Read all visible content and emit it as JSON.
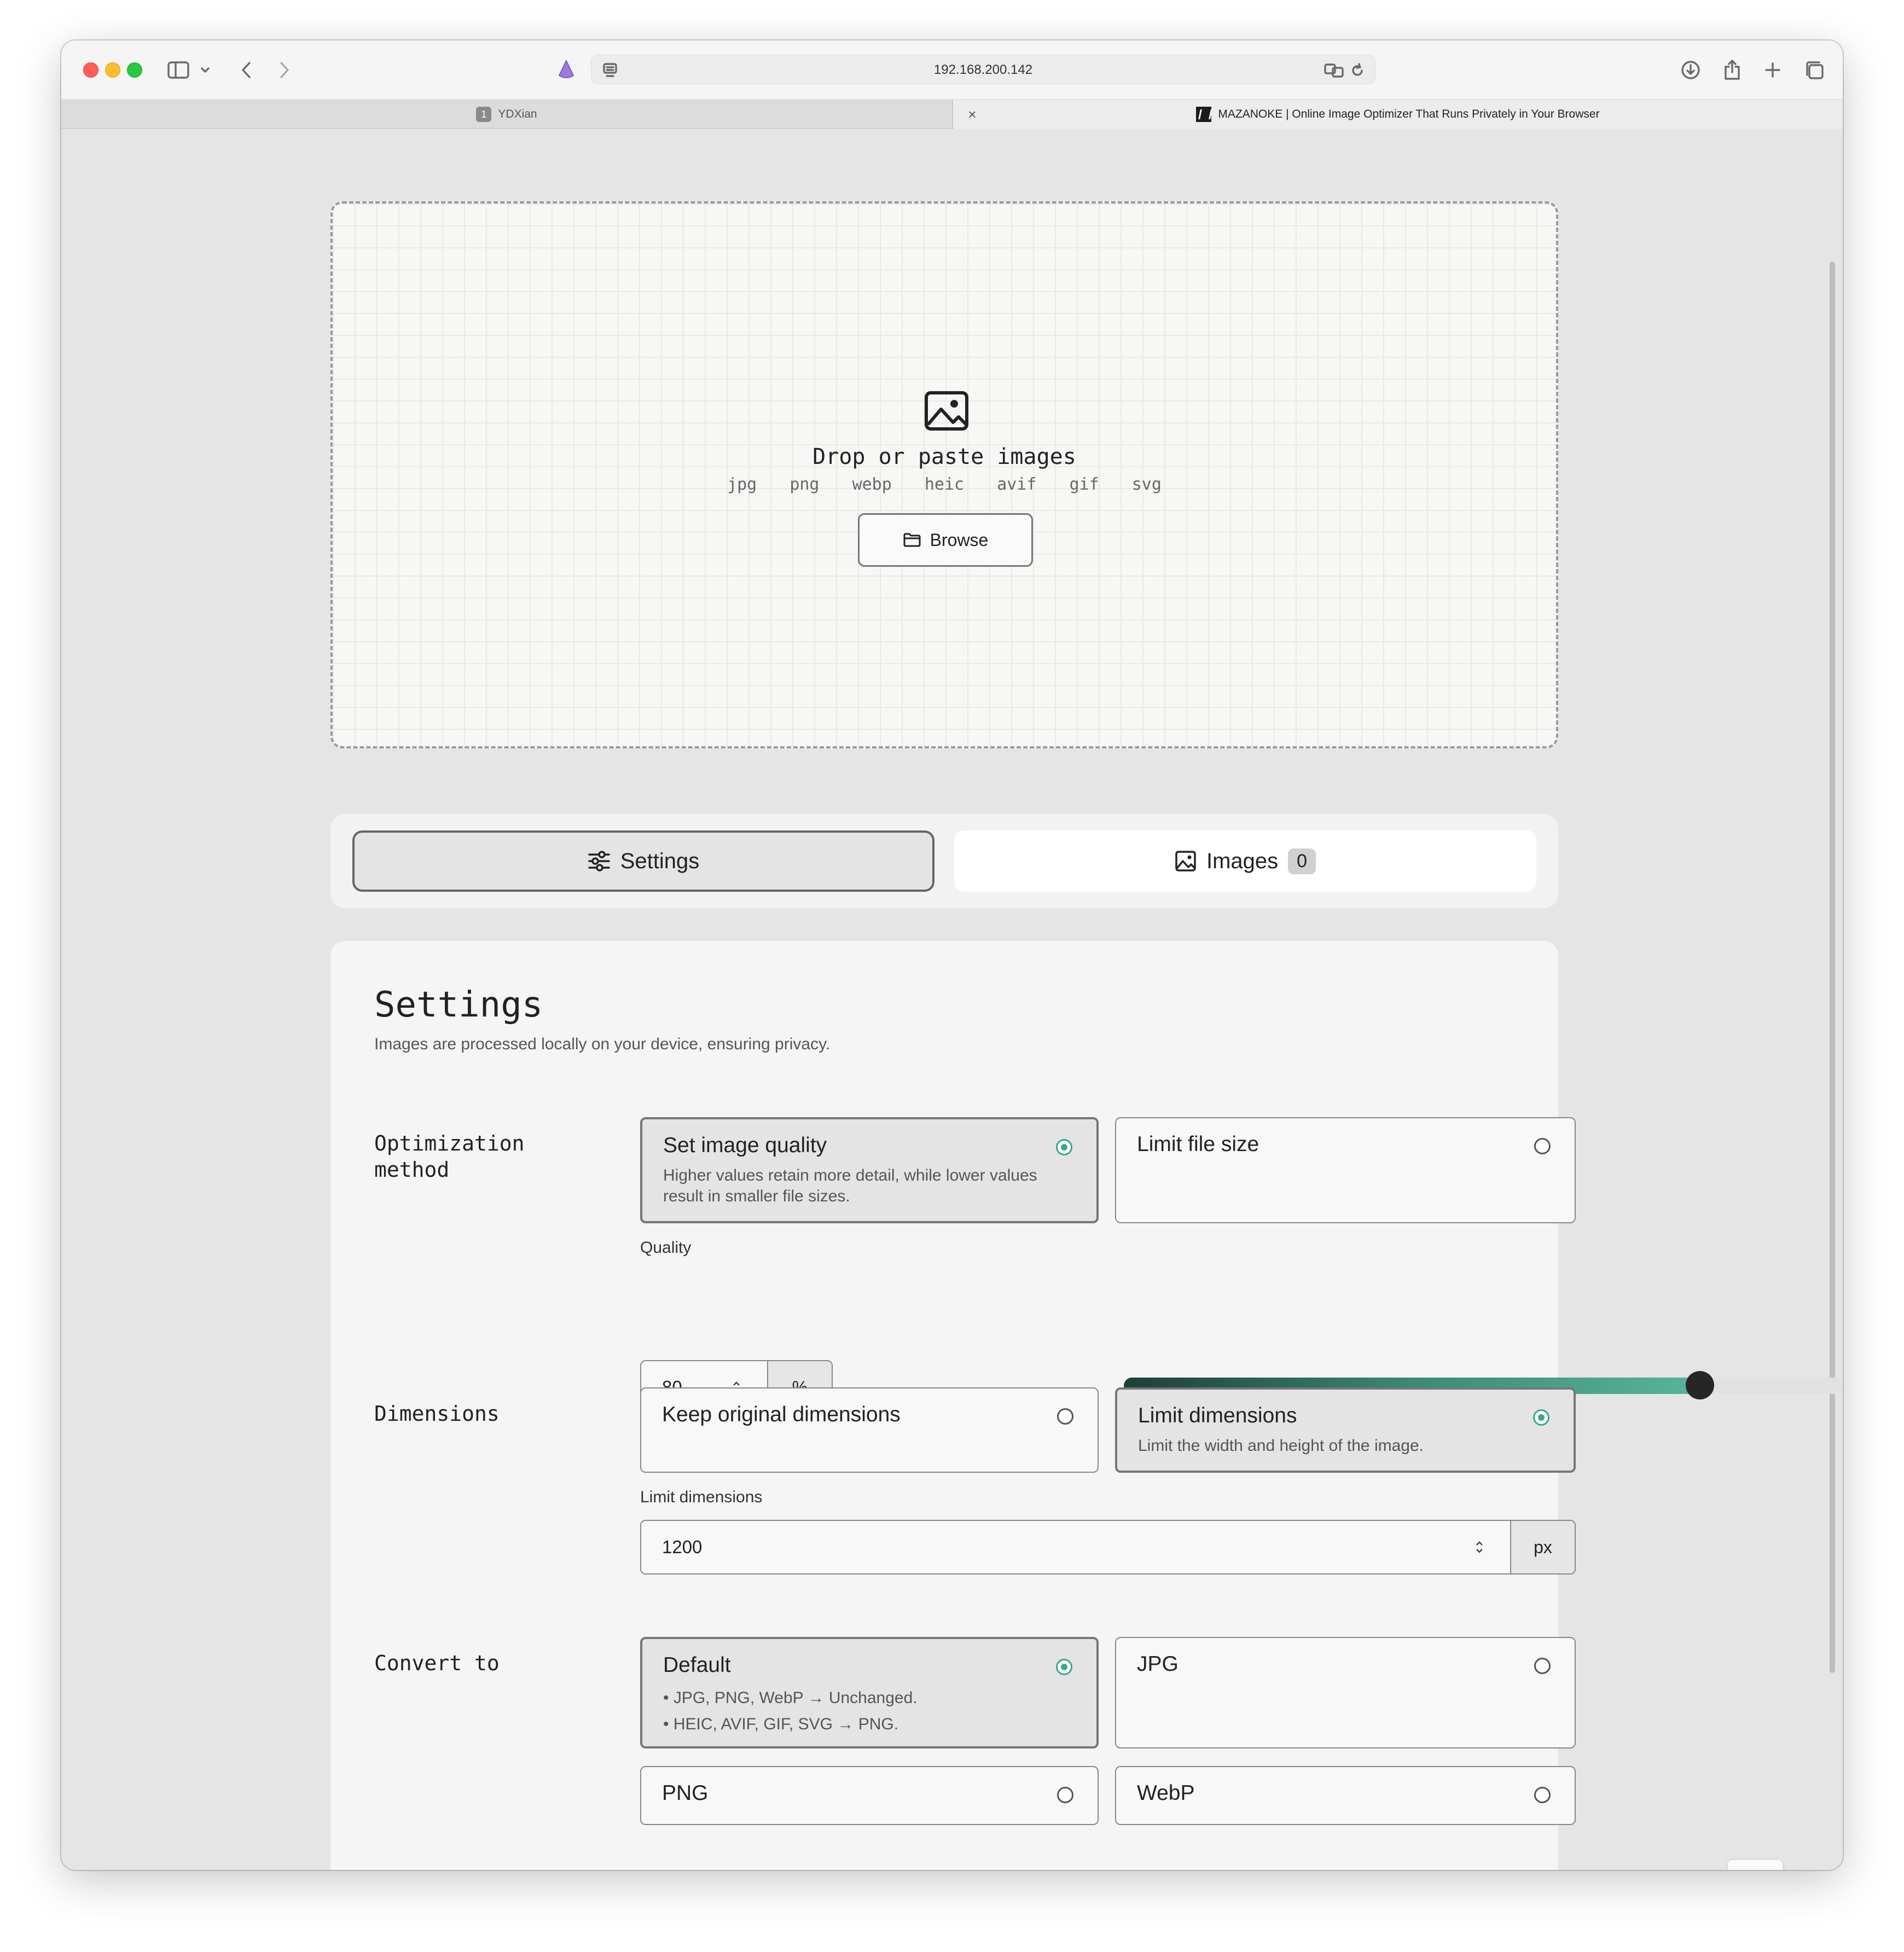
{
  "browser": {
    "url": "192.168.200.142",
    "tabs": [
      {
        "number": "1",
        "title": "YDXian"
      },
      {
        "title": "MAZANOKE | Online Image Optimizer That Runs Privately in Your Browser"
      }
    ]
  },
  "dropzone": {
    "title": "Drop or paste images",
    "formats": [
      "jpg",
      "png",
      "webp",
      "heic",
      "avif",
      "gif",
      "svg"
    ],
    "browse_label": "Browse"
  },
  "tabs": {
    "settings_label": "Settings",
    "images_label": "Images",
    "images_count": "0",
    "active": "settings"
  },
  "settings": {
    "title": "Settings",
    "subtitle": "Images are processed locally on your device, ensuring privacy.",
    "optimization": {
      "label_line1": "Optimization",
      "label_line2": "method",
      "options": [
        {
          "title": "Set image quality",
          "desc": "Higher values retain more detail, while lower values result in smaller file sizes.",
          "selected": true
        },
        {
          "title": "Limit file size",
          "desc": "",
          "selected": false
        }
      ],
      "quality_label": "Quality",
      "quality_value": "80",
      "quality_unit": "%",
      "slider_fraction": 0.8
    },
    "dimensions": {
      "label": "Dimensions",
      "options": [
        {
          "title": "Keep original dimensions",
          "desc": "",
          "selected": false
        },
        {
          "title": "Limit dimensions",
          "desc": "Limit the width and height of the image.",
          "selected": true
        }
      ],
      "limit_label": "Limit dimensions",
      "limit_value": "1200",
      "limit_unit": "px"
    },
    "convert": {
      "label": "Convert to",
      "options": [
        {
          "title": "Default",
          "desc_line1": "• JPG, PNG, WebP → Unchanged.",
          "desc_line2": "• HEIC, AVIF, GIF, SVG → PNG.",
          "selected": true
        },
        {
          "title": "JPG",
          "selected": false
        },
        {
          "title": "PNG",
          "selected": false
        },
        {
          "title": "WebP",
          "selected": false
        }
      ]
    }
  },
  "colors": {
    "accent": "#3aa88a",
    "slider_dark": "#1e3e37",
    "slider_light": "#58b49a"
  }
}
